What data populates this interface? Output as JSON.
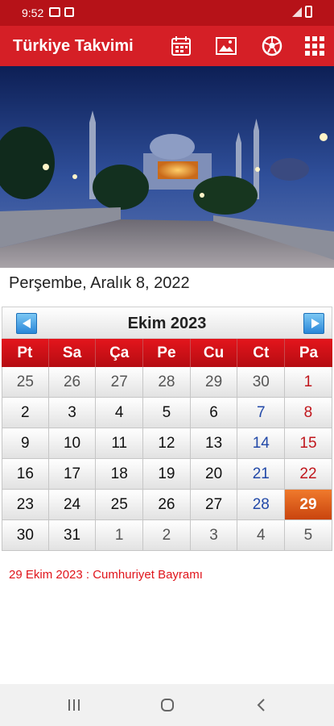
{
  "status_bar": {
    "time": "9:52",
    "icons": [
      "message-icon",
      "app-notification-icon",
      "signal-icon",
      "battery-icon"
    ]
  },
  "app_bar": {
    "title": "Türkiye Takvimi",
    "actions": [
      "calendar-icon",
      "image-icon",
      "football-icon",
      "apps-grid-icon"
    ]
  },
  "today_label": "Perşembe, Aralık 8, 2022",
  "calendar": {
    "month_title": "Ekim  2023",
    "weekdays": [
      "Pt",
      "Sa",
      "Ça",
      "Pe",
      "Cu",
      "Ct",
      "Pa"
    ],
    "rows": [
      [
        "25",
        "26",
        "27",
        "28",
        "29",
        "30",
        "1"
      ],
      [
        "2",
        "3",
        "4",
        "5",
        "6",
        "7",
        "8"
      ],
      [
        "9",
        "10",
        "11",
        "12",
        "13",
        "14",
        "15"
      ],
      [
        "16",
        "17",
        "18",
        "19",
        "20",
        "21",
        "22"
      ],
      [
        "23",
        "24",
        "25",
        "26",
        "27",
        "28",
        "29"
      ],
      [
        "30",
        "31",
        "1",
        "2",
        "3",
        "4",
        "5"
      ]
    ],
    "highlighted_day": "29"
  },
  "holiday_note": "29 Ekim 2023 : Cumhuriyet Bayramı",
  "colors": {
    "status_bar": "#b61218",
    "app_bar": "#d51f26",
    "weekday_header": "#d3121a",
    "holiday": "#e06322",
    "note": "#e0141b"
  }
}
